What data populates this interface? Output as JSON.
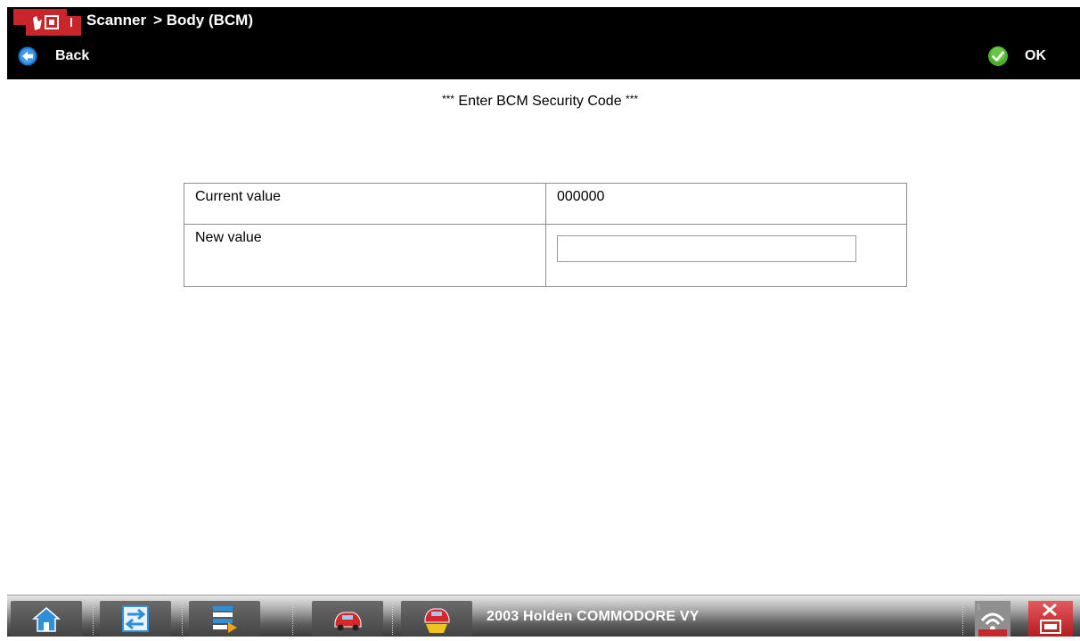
{
  "header": {
    "app_name": "Scanner",
    "breadcrumb": "> Body (BCM)",
    "back_label": "Back",
    "ok_label": "OK"
  },
  "main": {
    "title_stars_left": "***",
    "title": "Enter BCM Security Code",
    "title_stars_right": "***",
    "rows": [
      {
        "label": "Current value",
        "value": "000000"
      },
      {
        "label": "New value",
        "value": ""
      }
    ]
  },
  "taskbar": {
    "vehicle": "2003 Holden COMMODORE VY",
    "icons": [
      "home-icon",
      "data-transfer-icon",
      "data-list-icon",
      "vehicle-icon",
      "vehicle-info-icon",
      "connection-status-icon",
      "exit-icon"
    ]
  },
  "colors": {
    "header_bg": "#000000",
    "back_icon_blue": "#1a73c8",
    "ok_icon_green": "#4caf2a",
    "logo_red": "#c8262b"
  }
}
